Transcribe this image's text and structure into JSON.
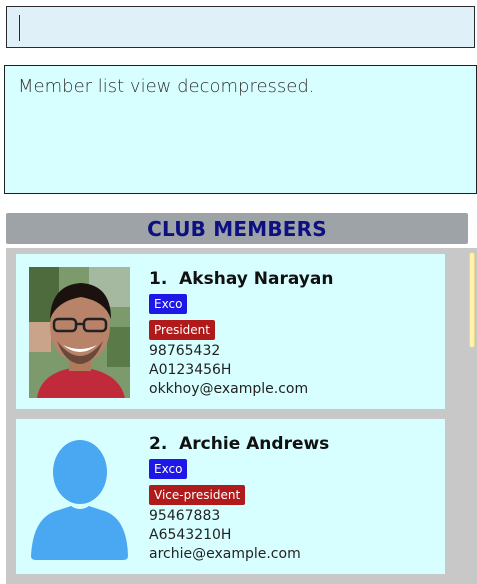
{
  "command_box": {
    "value": ""
  },
  "result_display": {
    "message": "Member list view decompressed."
  },
  "panel": {
    "title": "CLUB MEMBERS"
  },
  "members": [
    {
      "index": "1.",
      "name": "Akshay Narayan",
      "tags": [
        "Exco",
        "President"
      ],
      "phone": "98765432",
      "matric": "A0123456H",
      "email": "okkhoy@example.com",
      "photo": "profile-photo"
    },
    {
      "index": "2.",
      "name": "Archie Andrews",
      "tags": [
        "Exco",
        "Vice-president"
      ],
      "phone": "95467883",
      "matric": "A6543210H",
      "email": "archie@example.com",
      "photo": "default-avatar-icon"
    }
  ],
  "colors": {
    "tag_role": "#1d17e8",
    "tag_position": "#b01a1a",
    "card_bg": "#d8ffff",
    "header_text": "#0d1080"
  }
}
